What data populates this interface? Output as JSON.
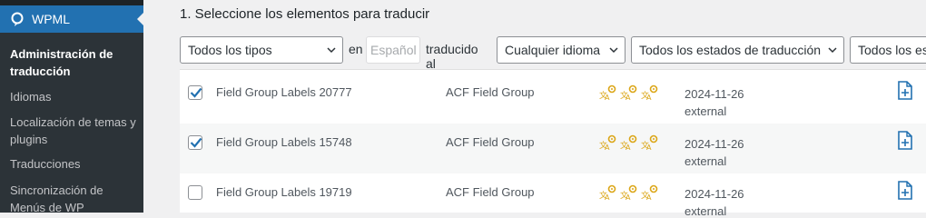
{
  "sidebar": {
    "app_name": "WPML",
    "items": [
      {
        "label": "Administración de traducción",
        "current": true
      },
      {
        "label": "Idiomas",
        "current": false
      },
      {
        "label": "Localización de temas y plugins",
        "current": false
      },
      {
        "label": "Traducciones",
        "current": false
      },
      {
        "label": "Sincronización de Menús de WP",
        "current": false
      }
    ]
  },
  "main": {
    "step_title": "1. Seleccione los elementos para traducir",
    "filters": {
      "type_select": "Todos los tipos",
      "in_label": "en",
      "source_language": "Español",
      "translated_to_label": "traducido al",
      "target_language_select": "Cualquier idioma",
      "status_select": "Todos los estados de traducción",
      "last_select": "Todos los es"
    },
    "rows": [
      {
        "title": "Field Group Labels 20777",
        "type": "ACF Field Group",
        "date": "2024-11-26",
        "source": "external",
        "checked": true
      },
      {
        "title": "Field Group Labels 15748",
        "type": "ACF Field Group",
        "date": "2024-11-26",
        "source": "external",
        "checked": true
      },
      {
        "title": "Field Group Labels 19719",
        "type": "ACF Field Group",
        "date": "2024-11-26",
        "source": "external",
        "checked": false
      }
    ],
    "status_icon": "translation-needed-icon",
    "action_icon": "document-plus-icon"
  },
  "colors": {
    "sidebar_bg": "#1d2327",
    "sidebar_active": "#2271b1",
    "status_icon": "#dba617",
    "action_icon": "#2271b1",
    "checkbox_check": "#2271b1"
  }
}
